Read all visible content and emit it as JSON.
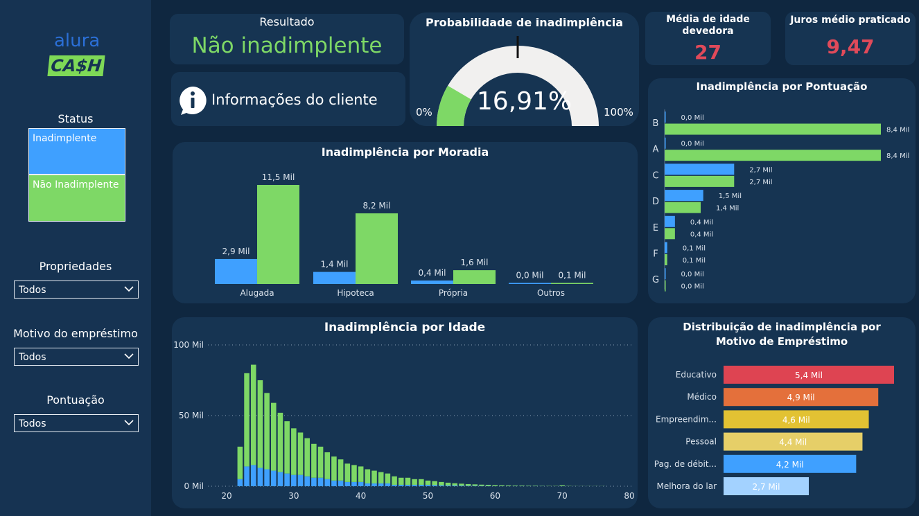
{
  "logo": {
    "top_text": "alura",
    "bottom_text": "CA$H"
  },
  "sidebar": {
    "status": {
      "title": "Status",
      "items": [
        "Inadimplente",
        "Não Inadimplente"
      ]
    },
    "filters": [
      {
        "title": "Propriedades",
        "value": "Todos"
      },
      {
        "title": "Motivo do empréstimo",
        "value": "Todos"
      },
      {
        "title": "Pontuação",
        "value": "Todos"
      }
    ]
  },
  "result": {
    "title": "Resultado",
    "value": "Não inadimplente"
  },
  "info": {
    "label": "Informações do cliente"
  },
  "gauge": {
    "title": "Probabilidade de inadimplência",
    "value_text": "16,91%",
    "value": 16.91,
    "min_label": "0%",
    "max_label": "100%"
  },
  "kpis": {
    "age": {
      "title": "Média de idade devedora",
      "value": "27"
    },
    "interest": {
      "title": "Juros médio praticado",
      "value": "9,47"
    }
  },
  "colors": {
    "inadimplente": "#3fa0ff",
    "nao_inadimplente": "#7ed866"
  },
  "chart_data": [
    {
      "type": "bar",
      "title": "Inadimplência por Moradia",
      "categories": [
        "Alugada",
        "Hipoteca",
        "Própria",
        "Outros"
      ],
      "series": [
        {
          "name": "Inadimplente",
          "values": [
            2.9,
            1.4,
            0.4,
            0.0
          ],
          "labels": [
            "2,9 Mil",
            "1,4 Mil",
            "0,4 Mil",
            "0,0 Mil"
          ]
        },
        {
          "name": "Não Inadimplente",
          "values": [
            11.5,
            8.2,
            1.6,
            0.1
          ],
          "labels": [
            "11,5 Mil",
            "8,2 Mil",
            "1,6 Mil",
            "0,1 Mil"
          ]
        }
      ]
    },
    {
      "type": "bar",
      "title": "Inadimplência por Pontuação",
      "orientation": "horizontal",
      "categories": [
        "B",
        "A",
        "C",
        "D",
        "E",
        "F",
        "G"
      ],
      "series": [
        {
          "name": "Inadimplente",
          "values": [
            0.0,
            0.0,
            2.7,
            1.5,
            0.4,
            0.1,
            0.0
          ],
          "labels": [
            "0,0 Mil",
            "0,0 Mil",
            "2,7 Mil",
            "1,5 Mil",
            "0,4 Mil",
            "0,1 Mil",
            "0,0 Mil"
          ]
        },
        {
          "name": "Não Inadimplente",
          "values": [
            8.4,
            8.4,
            2.7,
            1.4,
            0.4,
            0.1,
            0.0
          ],
          "labels": [
            "8,4 Mil",
            "8,4 Mil",
            "2,7 Mil",
            "1,4 Mil",
            "0,4 Mil",
            "0,1 Mil",
            "0,0 Mil"
          ]
        }
      ]
    },
    {
      "type": "bar",
      "title": "Inadimplência por Idade",
      "stacked": true,
      "x": [
        20,
        21,
        22,
        23,
        24,
        25,
        26,
        27,
        28,
        29,
        30,
        31,
        32,
        33,
        34,
        35,
        36,
        37,
        38,
        39,
        40,
        41,
        42,
        43,
        44,
        45,
        46,
        47,
        48,
        49,
        50,
        51,
        52,
        53,
        54,
        55,
        56,
        57,
        58,
        59,
        60,
        61,
        62,
        63,
        64,
        65,
        66,
        67,
        68,
        69,
        70,
        71,
        72,
        73,
        74,
        75,
        76,
        77,
        78,
        79,
        80
      ],
      "xlim": [
        20,
        80
      ],
      "yticks": [
        "0 Mil",
        "50 Mil",
        "100 Mil"
      ],
      "xticks": [
        "20",
        "30",
        "40",
        "50",
        "60",
        "70",
        "80"
      ],
      "ylim": [
        0,
        100
      ],
      "series": [
        {
          "name": "Inadimplente",
          "values": [
            0,
            0,
            5,
            14,
            15,
            13,
            12,
            11,
            10,
            9,
            8,
            8,
            7,
            6,
            6,
            5,
            4,
            4,
            3,
            3,
            3,
            2,
            2,
            2,
            2,
            1,
            1,
            1,
            1,
            1,
            1,
            0.8,
            0.6,
            0.5,
            0.5,
            0.4,
            0.3,
            0.3,
            0.2,
            0.2,
            0.1,
            0.1,
            0.1,
            0.1,
            0.1,
            0.1,
            0.1,
            0.1,
            0,
            0,
            0.1,
            0,
            0,
            0,
            0,
            0,
            0,
            0,
            0,
            0,
            0
          ]
        },
        {
          "name": "Não Inadimplente",
          "values": [
            0,
            0,
            23,
            66,
            71,
            62,
            54,
            48,
            42,
            37,
            33,
            30,
            27,
            24,
            22,
            19,
            17,
            15,
            13,
            12,
            11,
            10,
            9,
            8,
            7,
            6,
            5,
            5,
            4,
            4,
            3,
            2.8,
            2.4,
            2,
            1.6,
            1.4,
            1.2,
            1,
            0.9,
            0.8,
            0.7,
            0.6,
            0.5,
            0.4,
            0.4,
            0.3,
            0.3,
            0.2,
            0.2,
            0.2,
            0.6,
            0.2,
            0.1,
            0.1,
            0.1,
            0.1,
            0.1,
            0,
            0,
            0,
            0
          ]
        }
      ]
    },
    {
      "type": "bar",
      "title": "Distribuição de inadimplência por Motivo de Empréstimo",
      "orientation": "horizontal",
      "categories": [
        "Educativo",
        "Médico",
        "Empreendim...",
        "Pessoal",
        "Pag. de débit...",
        "Melhora do lar"
      ],
      "values": [
        5.4,
        4.9,
        4.6,
        4.4,
        4.2,
        2.7
      ],
      "labels": [
        "5,4 Mil",
        "4,9 Mil",
        "4,6 Mil",
        "4,4 Mil",
        "4,2 Mil",
        "2,7 Mil"
      ],
      "colors": [
        "#de4452",
        "#e4703b",
        "#e2c233",
        "#e6cf68",
        "#3fa0ff",
        "#a3d2ff"
      ]
    }
  ]
}
